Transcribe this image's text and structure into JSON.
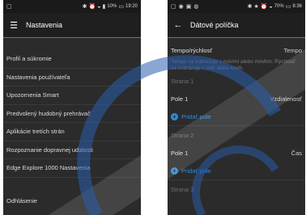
{
  "left_phone": {
    "status": {
      "right_text": "10%",
      "time": "19:20"
    },
    "appbar": {
      "title": "Nastavenia"
    },
    "menu": [
      "Profil a súkromie",
      "Nastavenia používateľa",
      "Upozornenia Smart",
      "Predvolený hudobný prehrávač",
      "Aplikácie tretích strán",
      "Rozpoznanie dopravnej udalosti",
      "Edge Explore 1000 Nastavenia"
    ],
    "logout": "Odhlásenie"
  },
  "right_phone": {
    "status": {
      "right_text": "70%",
      "time": "8:36"
    },
    "appbar": {
      "title": "Dátové políčka"
    },
    "pace": {
      "label": "Tempo/rýchlosť",
      "value": "Tempo"
    },
    "pace_desc": "Tempo sa zobrazuje v min/mi alebo min/km. Rýchlosť sa zobrazuje v m/h alebo km/h.",
    "screens": [
      {
        "section": "Strana 1",
        "field_label": "Pole 1",
        "field_value": "Vzdialenosť",
        "add_label": "Pridať pole"
      },
      {
        "section": "Strana 2",
        "field_label": "Pole 1",
        "field_value": "Čas",
        "add_label": "Pridať pole"
      },
      {
        "section": "Strana 3"
      }
    ]
  },
  "colors": {
    "accent": "#1e88e5",
    "add": "#2d8de0",
    "background": "#2b2b2b",
    "watermark": "#2a5fb0"
  }
}
